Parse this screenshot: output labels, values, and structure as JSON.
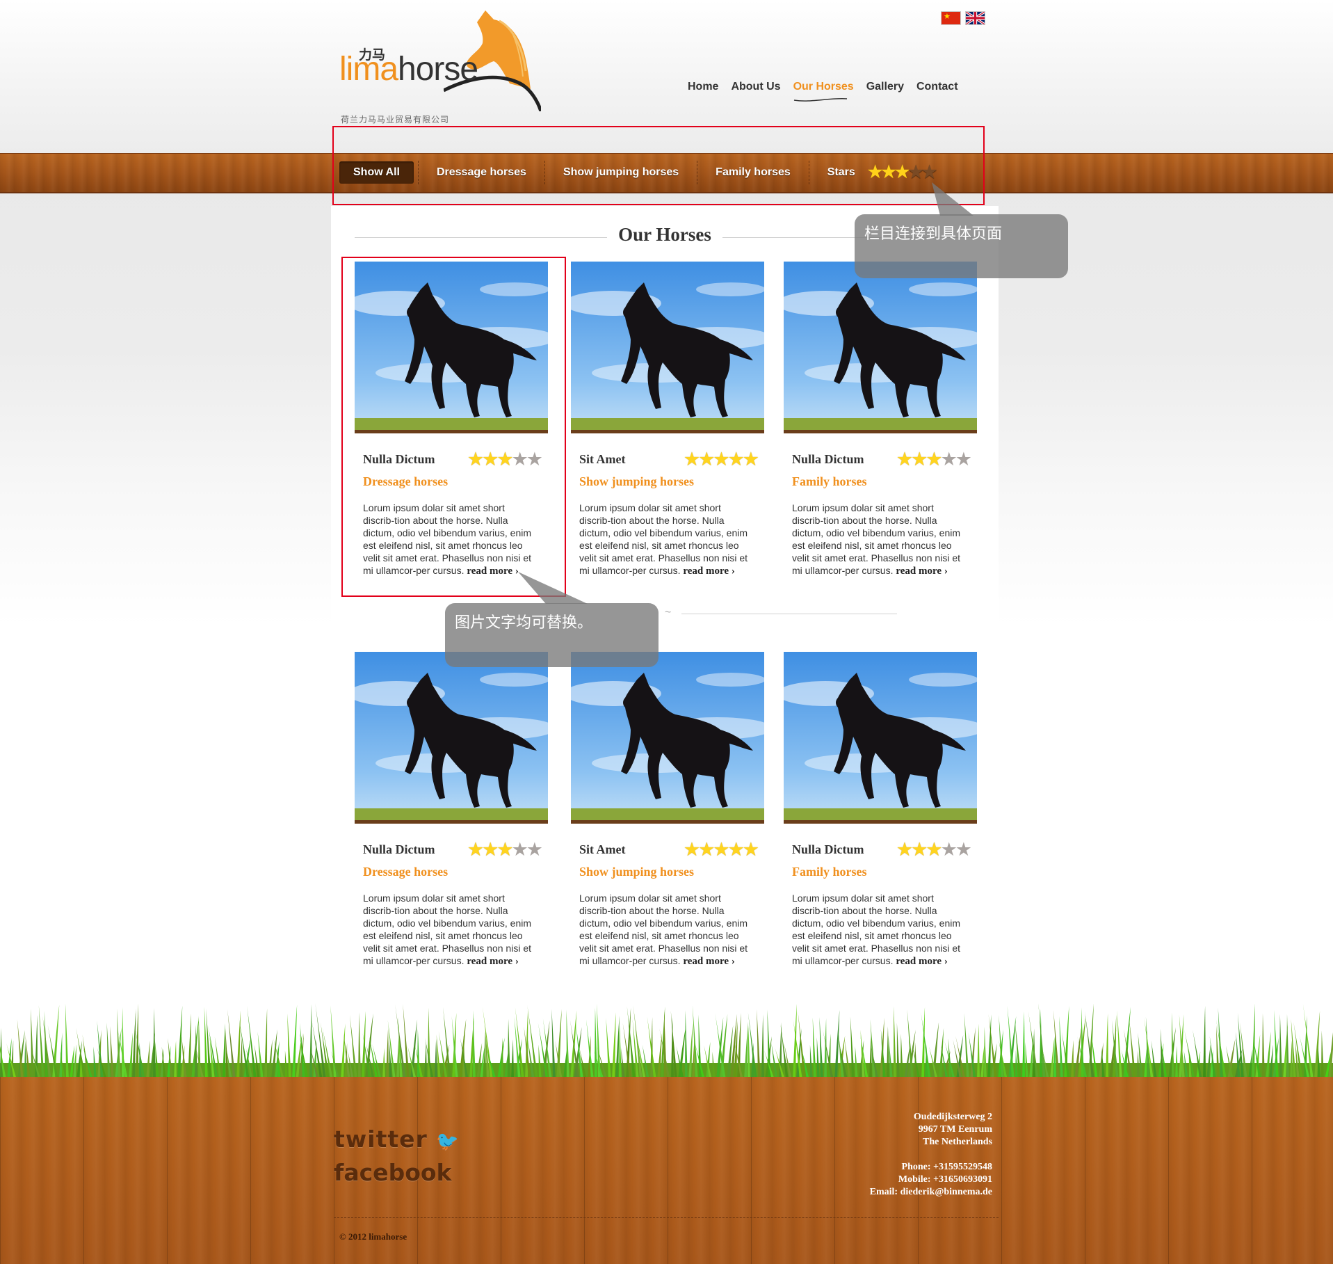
{
  "header": {
    "logo_cn": "力马",
    "logo_word_a": "lima",
    "logo_word_b": "horse",
    "logo_subtitle": "荷兰力马马业贸易有限公司",
    "nav": [
      "Home",
      "About Us",
      "Our Horses",
      "Gallery",
      "Contact"
    ],
    "active_nav": "Our Horses"
  },
  "filters": {
    "items": [
      "Show All",
      "Dressage horses",
      "Show jumping horses",
      "Family horses"
    ],
    "active": "Show All",
    "stars_label": "Stars",
    "stars_rating": 3,
    "stars_max": 5
  },
  "section_title": "Our Horses",
  "horses": [
    {
      "name": "Nulla Dictum",
      "stars": 3,
      "category": "Dressage horses",
      "desc": "Lorum ipsum dolar sit amet short discrib-tion about the horse. Nulla dictum, odio vel bibendum varius, enim est eleifend nisl, sit amet rhoncus leo velit sit amet erat. Phasellus non nisi et mi ullamcor-per cursus.",
      "read_more": "read more"
    },
    {
      "name": "Sit Amet",
      "stars": 5,
      "category": "Show jumping horses",
      "desc": "Lorum ipsum dolar sit amet short discrib-tion about the horse. Nulla dictum, odio vel bibendum varius, enim est eleifend nisl, sit amet rhoncus leo velit sit amet erat. Phasellus non nisi et mi ullamcor-per cursus.",
      "read_more": "read more"
    },
    {
      "name": "Nulla Dictum",
      "stars": 3,
      "category": "Family horses",
      "desc": "Lorum ipsum dolar sit amet short discrib-tion about the horse. Nulla dictum, odio vel bibendum varius, enim est eleifend nisl, sit amet rhoncus leo velit sit amet erat. Phasellus non nisi et mi ullamcor-per cursus.",
      "read_more": "read more"
    },
    {
      "name": "Nulla Dictum",
      "stars": 3,
      "category": "Dressage horses",
      "desc": "Lorum ipsum dolar sit amet short discrib-tion about the horse. Nulla dictum, odio vel bibendum varius, enim est eleifend nisl, sit amet rhoncus leo velit sit amet erat. Phasellus non nisi et mi ullamcor-per cursus.",
      "read_more": "read more"
    },
    {
      "name": "Sit Amet",
      "stars": 5,
      "category": "Show jumping horses",
      "desc": "Lorum ipsum dolar sit amet short discrib-tion about the horse. Nulla dictum, odio vel bibendum varius, enim est eleifend nisl, sit amet rhoncus leo velit sit amet erat. Phasellus non nisi et mi ullamcor-per cursus.",
      "read_more": "read more"
    },
    {
      "name": "Nulla Dictum",
      "stars": 3,
      "category": "Family horses",
      "desc": "Lorum ipsum dolar sit amet short discrib-tion about the horse. Nulla dictum, odio vel bibendum varius, enim est eleifend nisl, sit amet rhoncus leo velit sit amet erat. Phasellus non nisi et mi ullamcor-per cursus.",
      "read_more": "read more"
    }
  ],
  "annotations": {
    "nav_note": "栏目连接到具体页面",
    "card_note": "图片文字均可替换。"
  },
  "footer": {
    "twitter": "twitter",
    "facebook": "facebook",
    "address": [
      "Oudedijksterweg 2",
      "9967 TM Eenrum",
      "The Netherlands"
    ],
    "contact": [
      "Phone: +31595529548",
      "Mobile: +31650693091",
      "Email: diederik@binnema.de"
    ],
    "copyright": "© 2012 limahorse"
  },
  "colors": {
    "accent": "#f0901e",
    "wood": "#a6561a",
    "annotation_red": "#e2001a"
  }
}
